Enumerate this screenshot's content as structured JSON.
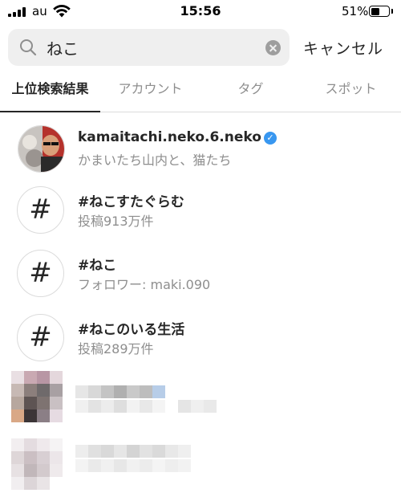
{
  "status_bar": {
    "carrier": "au",
    "time": "15:56",
    "battery_percent": "51%",
    "battery_level": 0.51
  },
  "search": {
    "query": "ねこ",
    "cancel_label": "キャンセル"
  },
  "tabs": [
    {
      "label": "上位検索結果",
      "active": true
    },
    {
      "label": "アカウント",
      "active": false
    },
    {
      "label": "タグ",
      "active": false
    },
    {
      "label": "スポット",
      "active": false
    }
  ],
  "results": [
    {
      "type": "account",
      "title": "kamaitachi.neko.6.neko",
      "verified": true,
      "subtitle": "かまいたち山内と、猫たち"
    },
    {
      "type": "hashtag",
      "icon": "#",
      "title": "#ねこすたぐらむ",
      "subtitle": "投稿913万件"
    },
    {
      "type": "hashtag",
      "icon": "#",
      "title": "#ねこ",
      "subtitle": "フォロワー: maki.090"
    },
    {
      "type": "hashtag",
      "icon": "#",
      "title": "#ねこのいる生活",
      "subtitle": "投稿289万件"
    }
  ],
  "colors": {
    "verified_badge": "#3897f0",
    "secondary_text": "#8e8e8e",
    "search_bg": "#efefef"
  }
}
